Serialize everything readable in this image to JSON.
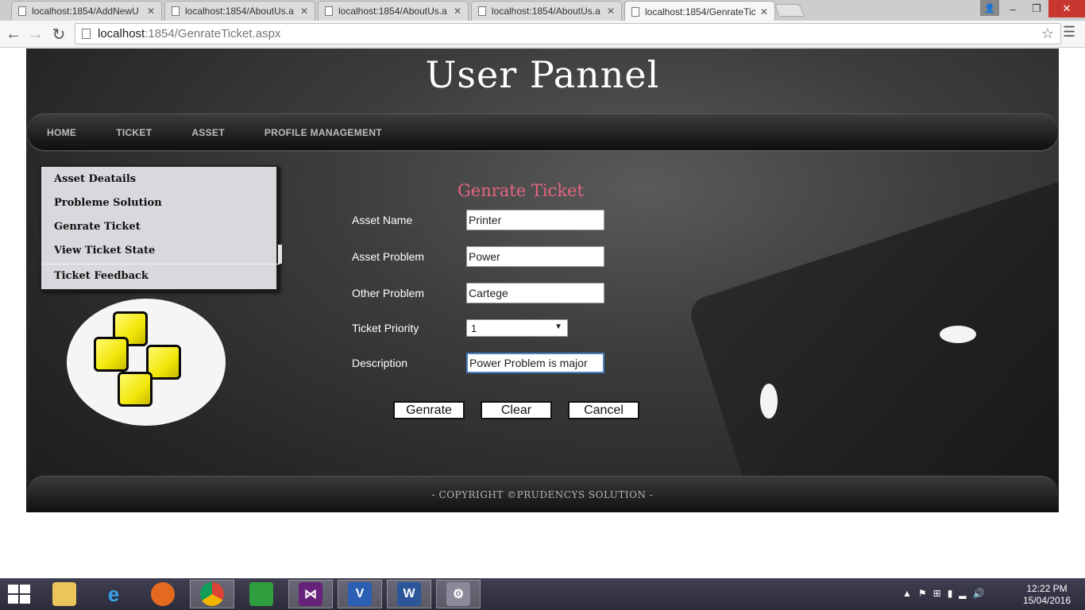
{
  "browser": {
    "tabs": [
      {
        "label": "localhost:1854/AddNewU"
      },
      {
        "label": "localhost:1854/AboutUs.a"
      },
      {
        "label": "localhost:1854/AboutUs.a"
      },
      {
        "label": "localhost:1854/AboutUs.a"
      },
      {
        "label": "localhost:1854/GenrateTic"
      }
    ],
    "url_host": "localhost",
    "url_path": ":1854/GenrateTicket.aspx"
  },
  "site": {
    "title": "User Pannel",
    "nav": [
      "HOME",
      "TICKET",
      "ASSET",
      "PROFILE MANAGEMENT"
    ],
    "sidemenu": [
      "Asset Deatails",
      "Probleme Solution",
      "Genrate Ticket",
      "View Ticket State",
      "Ticket Feedback"
    ],
    "footer": "- COPYRIGHT ©PRUDENCYS SOLUTION -"
  },
  "form": {
    "title": "Genrate Ticket",
    "asset_name_label": "Asset Name",
    "asset_name_value": "Printer",
    "asset_problem_label": "Asset Problem",
    "asset_problem_value": "Power",
    "other_problem_label": "Other Problem",
    "other_problem_value": "Cartege",
    "priority_label": "Ticket Priority",
    "priority_value": "1",
    "description_label": "Description",
    "description_value": "Power Problem is major",
    "buttons": {
      "generate": "Genrate",
      "clear": "Clear",
      "cancel": "Cancel"
    }
  },
  "taskbar": {
    "time": "12:22 PM",
    "date": "15/04/2016"
  }
}
